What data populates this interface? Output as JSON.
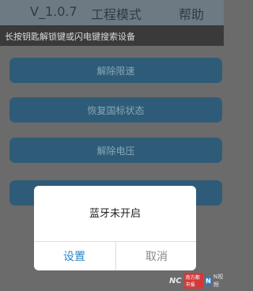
{
  "topbar": {
    "version": "V_1.0.7",
    "title": "工程模式",
    "help": "帮助"
  },
  "hint": "长按钥匙解锁键或闪电键搜索设备",
  "actions": [
    {
      "label": "解除限速"
    },
    {
      "label": "恢复国标状态"
    },
    {
      "label": "解除电压"
    },
    {
      "label": ""
    }
  ],
  "dialog": {
    "message": "蓝牙未开启",
    "confirm": "设置",
    "cancel": "取消"
  },
  "watermark": {
    "mark": "NC",
    "tag": "南方都市报",
    "n_letter": "N",
    "text": "N视频"
  }
}
